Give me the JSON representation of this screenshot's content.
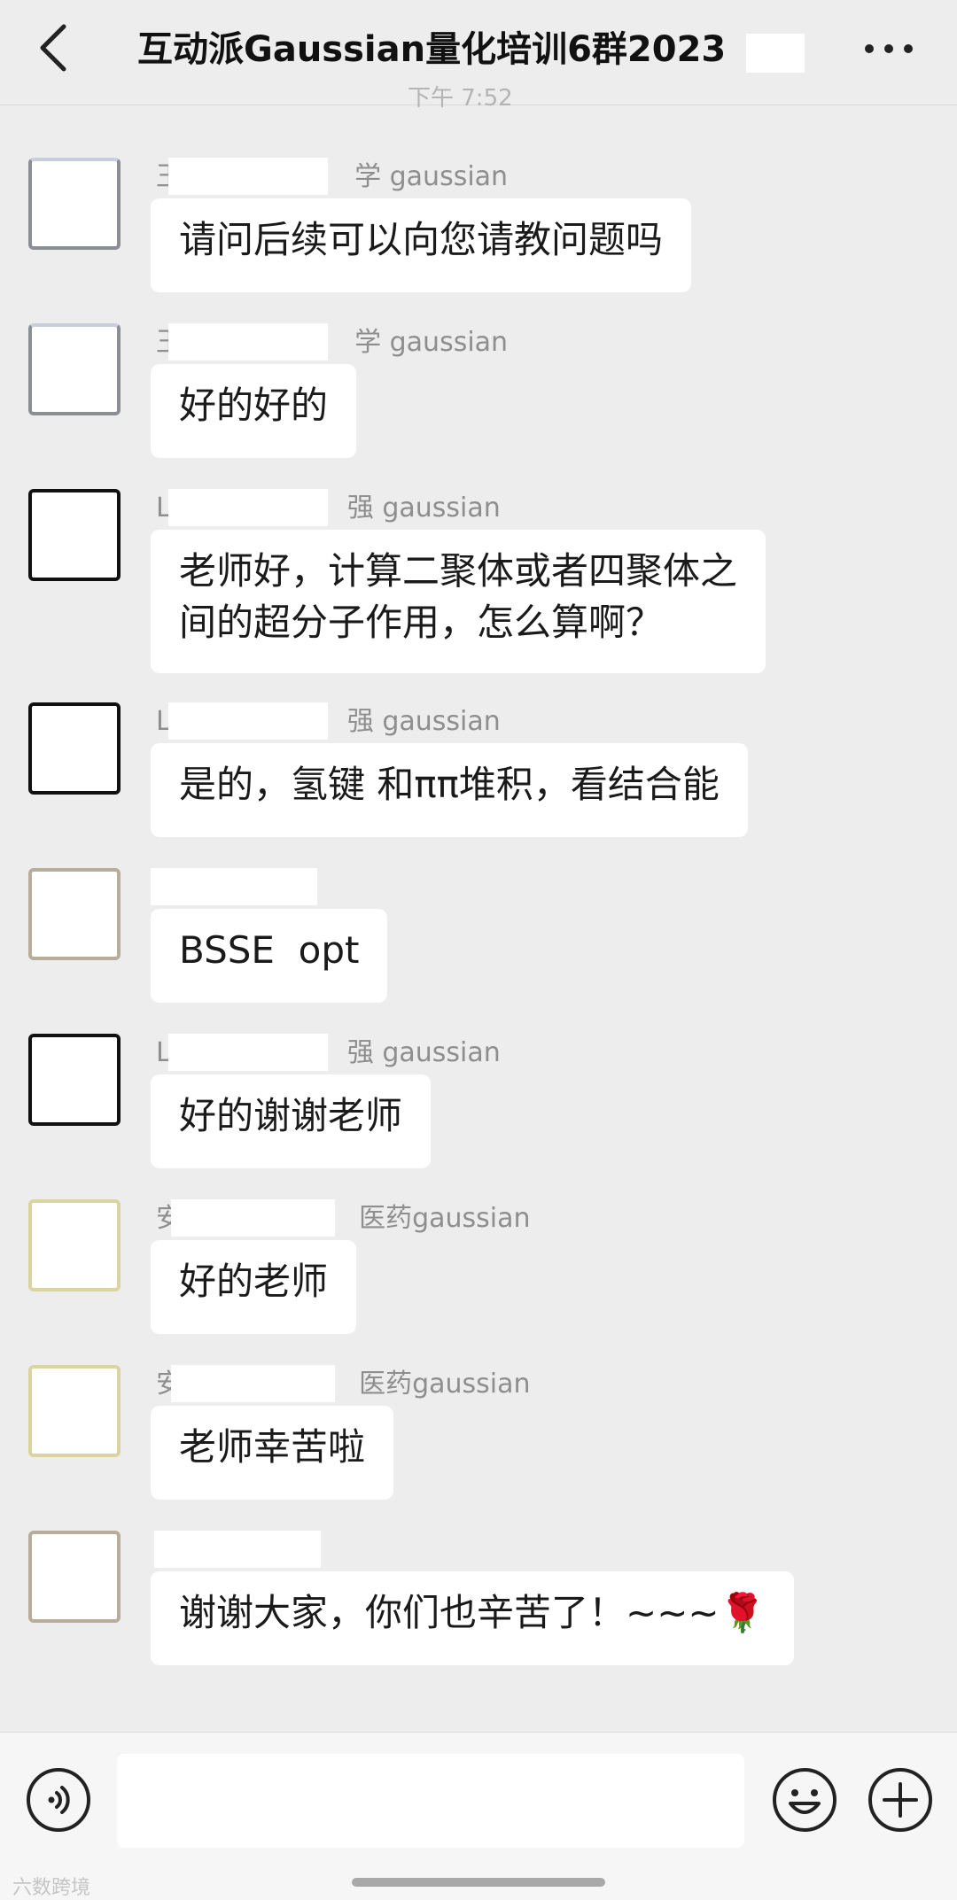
{
  "header": {
    "back_icon": "chevron-left-icon",
    "title": "互动派Gaussian量化培训6群2023",
    "more_icon": "more-dots-icon",
    "time_fragment": "下午 7:52"
  },
  "messages": [
    {
      "sender_prefix": "王",
      "sender_suffix": "学 gaussian",
      "text": "请问后续可以向您请教问题吗"
    },
    {
      "sender_prefix": "王",
      "sender_suffix": "学 gaussian",
      "text": "好的好的"
    },
    {
      "sender_prefix": "L",
      "sender_suffix": "强 gaussian",
      "text": "老师好，计算二聚体或者四聚体之\n间的超分子作用，怎么算啊？"
    },
    {
      "sender_prefix": "L",
      "sender_suffix": "强 gaussian",
      "text": "是的，氢键 和ππ堆积，看结合能"
    },
    {
      "sender_prefix": "",
      "sender_suffix": "",
      "text": "BSSE  opt"
    },
    {
      "sender_prefix": "L",
      "sender_suffix": "强 gaussian",
      "text": "好的谢谢老师"
    },
    {
      "sender_prefix": "安",
      "sender_suffix": "医药gaussian",
      "text": "好的老师"
    },
    {
      "sender_prefix": "安",
      "sender_suffix": "医药gaussian",
      "text": "老师幸苦啦"
    },
    {
      "sender_prefix": "",
      "sender_suffix": "",
      "text": "谢谢大家，你们也辛苦了！~~~🌹"
    }
  ],
  "input_bar": {
    "voice_icon": "voice-icon",
    "input_placeholder": "",
    "emoji_icon": "emoji-icon",
    "plus_icon": "plus-icon",
    "watermark": "六数跨境"
  }
}
